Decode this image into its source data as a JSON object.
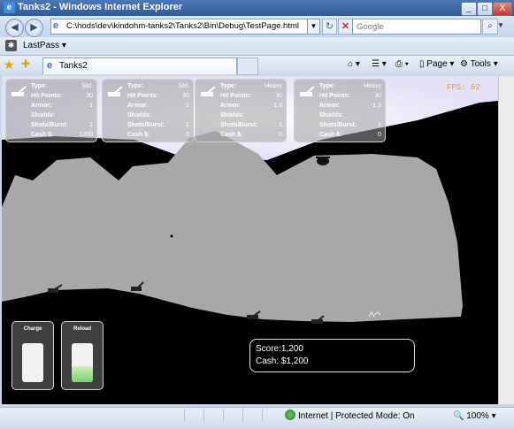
{
  "window": {
    "title": "Tanks2 - Windows Internet Explorer",
    "controls": {
      "minimize": "_",
      "maximize": "□",
      "close": "X"
    }
  },
  "addressbar": {
    "url": "C:\\hods\\dev\\kindohm-tanks2\\Tanks2\\Bin\\Debug\\TestPage.html",
    "search_placeholder": "Google"
  },
  "toolbar": {
    "lastpass_label": "LastPass",
    "tab_label": "Tanks2",
    "page_label": "Page",
    "tools_label": "Tools"
  },
  "game": {
    "fps_label": "FPS: 62",
    "panels": [
      {
        "type": "Std.",
        "hit_points": "30",
        "armor": "1",
        "shields": "",
        "shots_burst": "1",
        "cash": "1200"
      },
      {
        "type": "Std.",
        "hit_points": "30",
        "armor": "1",
        "shields": "",
        "shots_burst": "1",
        "cash": "0"
      },
      {
        "type": "Heavy",
        "hit_points": "30",
        "armor": "1.3",
        "shields": "",
        "shots_burst": "1",
        "cash": "0"
      },
      {
        "type": "Heavy",
        "hit_points": "30",
        "armor": "1.3",
        "shields": "",
        "shots_burst": "1",
        "cash": "0"
      }
    ],
    "labels": {
      "type": "Type:",
      "hit_points": "Hit Points:",
      "armor": "Armor:",
      "shields": "Shields:",
      "shots_burst": "Shots/Burst:",
      "cash": "Cash $:"
    },
    "charge_label": "Charge",
    "charge_level": 0.0,
    "reload_label": "Reload",
    "reload_level": 0.4,
    "score_line": "Score:1,200",
    "cash_line": "Cash: $1,200",
    "colors": {
      "terrain": "#a8a8a8",
      "sky": "#000000",
      "fps": "#e8a020"
    }
  },
  "statusbar": {
    "zone": "Internet | Protected Mode: On",
    "zoom": "100%"
  }
}
